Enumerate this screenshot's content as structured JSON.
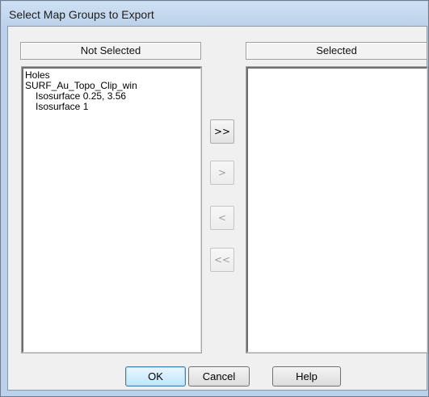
{
  "window": {
    "title": "Select Map Groups to Export"
  },
  "not_selected": {
    "header": "Not Selected",
    "items": [
      {
        "label": "Holes",
        "level": 0
      },
      {
        "label": "SURF_Au_Topo_Clip_win",
        "level": 0
      },
      {
        "label": "Isosurface 0.25, 3.56",
        "level": 1
      },
      {
        "label": "Isosurface 1",
        "level": 1
      }
    ]
  },
  "selected": {
    "header": "Selected",
    "items": []
  },
  "move_buttons": {
    "add_all": ">>",
    "add": ">",
    "remove": "<",
    "remove_all": "<<"
  },
  "footer": {
    "ok_label": "OK",
    "cancel_label": "Cancel",
    "help_label": "Help"
  }
}
